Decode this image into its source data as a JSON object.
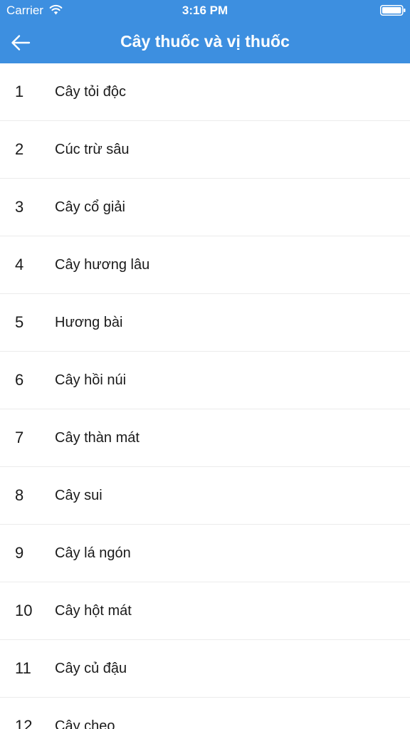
{
  "status_bar": {
    "carrier": "Carrier",
    "time": "3:16 PM",
    "icons": [
      "wifi-icon",
      "battery-icon"
    ]
  },
  "nav": {
    "title": "Cây thuốc và vị thuốc",
    "back_icon": "back-arrow-icon"
  },
  "colors": {
    "header_background": "#3d8fe0",
    "header_text": "#ffffff",
    "list_text": "#1a1a1a",
    "divider": "#ececec"
  },
  "plants": [
    {
      "number": "1",
      "name": "Cây tỏi độc"
    },
    {
      "number": "2",
      "name": "Cúc trừ sâu"
    },
    {
      "number": "3",
      "name": "Cây cổ giải"
    },
    {
      "number": "4",
      "name": "Cây hương lâu"
    },
    {
      "number": "5",
      "name": "Hương bài"
    },
    {
      "number": "6",
      "name": "Cây hồi núi"
    },
    {
      "number": "7",
      "name": "Cây thàn mát"
    },
    {
      "number": "8",
      "name": "Cây sui"
    },
    {
      "number": "9",
      "name": "Cây lá ngón"
    },
    {
      "number": "10",
      "name": "Cây hột mát"
    },
    {
      "number": "11",
      "name": "Cây củ đậu"
    },
    {
      "number": "12",
      "name": "Cây cheo"
    }
  ]
}
